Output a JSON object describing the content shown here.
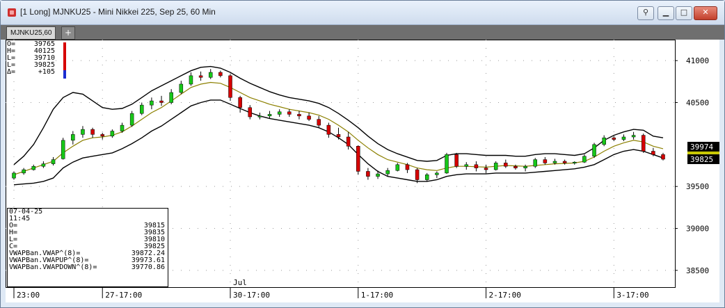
{
  "window": {
    "title": "[1 Long]  MJNKU25 - Mini Nikkei 225, Sep 25, 60 Min",
    "tab_label": "MJNKU25,60",
    "tab_add_label": "+"
  },
  "ohlc_box": [
    {
      "k": "O=",
      "v": "39765"
    },
    {
      "k": "H=",
      "v": "40125"
    },
    {
      "k": "L=",
      "v": "39710"
    },
    {
      "k": "L=",
      "v": "39825"
    },
    {
      "k": "Δ=",
      "v": "+105"
    }
  ],
  "info_box": {
    "date": "07-04-25",
    "time": "11:45",
    "rows": [
      {
        "k": "O=",
        "v": "39815"
      },
      {
        "k": "H=",
        "v": "39835"
      },
      {
        "k": "L=",
        "v": "39810"
      },
      {
        "k": "C=",
        "v": "39825"
      },
      {
        "k": "VWAPBan.VWAP^(8)=",
        "v": "39872.24"
      },
      {
        "k": "VWAPBan.VWAPUP^(8)=",
        "v": "39973.61"
      },
      {
        "k": "VWAPBan.VWAPDOWN^(8)=",
        "v": "39770.86"
      }
    ]
  },
  "colors": {
    "up": "#18c718",
    "down": "#d60000",
    "vwap": "#8c8000",
    "band": "#000000",
    "price_marker": "#000000",
    "vwap_marker": "#c8c800"
  },
  "chart_data": {
    "type": "candlestick",
    "title": "MJNKU25 - Mini Nikkei 225, Sep 25, 60 Min",
    "ylim": [
      38300,
      41250
    ],
    "y_ticks": [
      41000,
      40500,
      39500,
      39000,
      38500
    ],
    "y_tick_labels": [
      "41000",
      "40500",
      "39500",
      "39000",
      "38500"
    ],
    "x_labels": [
      {
        "label": "23:00",
        "index": 0
      },
      {
        "label": "27-17:00",
        "index": 9
      },
      {
        "label": "30-17:00",
        "index": 22
      },
      {
        "label": "1-17:00",
        "index": 35
      },
      {
        "label": "2-17:00",
        "index": 48
      },
      {
        "label": "3-17:00",
        "index": 61
      }
    ],
    "month_label": {
      "label": "Jul",
      "index": 22
    },
    "price_markers": [
      {
        "label": "39974",
        "value": 39974,
        "kind": "price"
      },
      {
        "label": "39825",
        "value": 39825,
        "kind": "price"
      }
    ],
    "candles": [
      [
        39600,
        39680,
        39580,
        39660
      ],
      [
        39660,
        39720,
        39640,
        39700
      ],
      [
        39700,
        39760,
        39690,
        39740
      ],
      [
        39740,
        39800,
        39720,
        39770
      ],
      [
        39770,
        39850,
        39750,
        39820
      ],
      [
        39830,
        40080,
        39820,
        40050
      ],
      [
        40050,
        40160,
        40000,
        40120
      ],
      [
        40120,
        40220,
        40080,
        40180
      ],
      [
        40180,
        40200,
        40080,
        40120
      ],
      [
        40120,
        40140,
        40060,
        40100
      ],
      [
        40100,
        40180,
        40080,
        40160
      ],
      [
        40160,
        40260,
        40140,
        40230
      ],
      [
        40230,
        40400,
        40210,
        40370
      ],
      [
        40370,
        40500,
        40350,
        40470
      ],
      [
        40470,
        40560,
        40420,
        40520
      ],
      [
        40520,
        40580,
        40460,
        40500
      ],
      [
        40500,
        40660,
        40480,
        40620
      ],
      [
        40620,
        40760,
        40600,
        40720
      ],
      [
        40720,
        40860,
        40700,
        40820
      ],
      [
        40820,
        40870,
        40760,
        40800
      ],
      [
        40800,
        40900,
        40780,
        40860
      ],
      [
        40860,
        40880,
        40800,
        40820
      ],
      [
        40820,
        40840,
        40520,
        40560
      ],
      [
        40560,
        40580,
        40380,
        40440
      ],
      [
        40440,
        40470,
        40300,
        40330
      ],
      [
        40330,
        40380,
        40300,
        40340
      ],
      [
        40340,
        40400,
        40310,
        40360
      ],
      [
        40360,
        40420,
        40330,
        40390
      ],
      [
        40390,
        40420,
        40330,
        40360
      ],
      [
        40360,
        40400,
        40300,
        40340
      ],
      [
        40340,
        40380,
        40280,
        40300
      ],
      [
        40300,
        40340,
        40200,
        40230
      ],
      [
        40230,
        40260,
        40080,
        40120
      ],
      [
        40120,
        40200,
        40060,
        40090
      ],
      [
        40090,
        40150,
        39940,
        39980
      ],
      [
        39980,
        39990,
        39640,
        39680
      ],
      [
        39680,
        39720,
        39580,
        39620
      ],
      [
        39620,
        39690,
        39590,
        39650
      ],
      [
        39650,
        39720,
        39620,
        39690
      ],
      [
        39690,
        39780,
        39680,
        39760
      ],
      [
        39760,
        39780,
        39660,
        39700
      ],
      [
        39700,
        39720,
        39540,
        39580
      ],
      [
        39580,
        39660,
        39560,
        39640
      ],
      [
        39640,
        39680,
        39600,
        39660
      ],
      [
        39660,
        39900,
        39650,
        39880
      ],
      [
        39880,
        39900,
        39720,
        39740
      ],
      [
        39740,
        39790,
        39700,
        39760
      ],
      [
        39760,
        39800,
        39680,
        39720
      ],
      [
        39720,
        39760,
        39660,
        39700
      ],
      [
        39700,
        39800,
        39690,
        39780
      ],
      [
        39780,
        39820,
        39720,
        39740
      ],
      [
        39740,
        39760,
        39700,
        39720
      ],
      [
        39720,
        39760,
        39680,
        39740
      ],
      [
        39740,
        39840,
        39720,
        39820
      ],
      [
        39820,
        39850,
        39760,
        39780
      ],
      [
        39780,
        39830,
        39760,
        39800
      ],
      [
        39800,
        39820,
        39760,
        39780
      ],
      [
        39780,
        39800,
        39760,
        39790
      ],
      [
        39790,
        39880,
        39780,
        39860
      ],
      [
        39860,
        40020,
        39840,
        40000
      ],
      [
        40000,
        40110,
        39980,
        40080
      ],
      [
        40080,
        40100,
        40040,
        40060
      ],
      [
        40060,
        40120,
        40040,
        40090
      ],
      [
        40090,
        40150,
        40060,
        40110
      ],
      [
        40110,
        40130,
        39900,
        39920
      ],
      [
        39920,
        39960,
        39860,
        39880
      ],
      [
        39880,
        39900,
        39810,
        39825
      ]
    ],
    "series": [
      {
        "name": "VWAPBan.VWAP^(8)",
        "values": [
          39640,
          39680,
          39720,
          39760,
          39800,
          39900,
          39980,
          40050,
          40080,
          40090,
          40110,
          40150,
          40220,
          40300,
          40380,
          40440,
          40520,
          40600,
          40680,
          40720,
          40740,
          40730,
          40680,
          40620,
          40560,
          40520,
          40480,
          40450,
          40420,
          40400,
          40380,
          40350,
          40300,
          40230,
          40150,
          40050,
          39960,
          39880,
          39820,
          39790,
          39760,
          39720,
          39700,
          39690,
          39720,
          39740,
          39740,
          39735,
          39730,
          39740,
          39750,
          39745,
          39740,
          39750,
          39760,
          39770,
          39775,
          39780,
          39800,
          39850,
          39920,
          39980,
          40020,
          40050,
          40030,
          39980,
          39950
        ]
      },
      {
        "name": "VWAPBan.VWAPUP^(8)",
        "values": [
          39760,
          39860,
          40000,
          40200,
          40420,
          40560,
          40620,
          40600,
          40520,
          40440,
          40420,
          40430,
          40480,
          40560,
          40640,
          40700,
          40760,
          40820,
          40880,
          40920,
          40930,
          40910,
          40860,
          40790,
          40730,
          40680,
          40630,
          40590,
          40560,
          40540,
          40520,
          40490,
          40440,
          40370,
          40290,
          40200,
          40100,
          40010,
          39940,
          39890,
          39850,
          39810,
          39800,
          39810,
          39870,
          39890,
          39890,
          39880,
          39870,
          39870,
          39870,
          39860,
          39860,
          39880,
          39890,
          39890,
          39880,
          39870,
          39890,
          39960,
          40050,
          40110,
          40150,
          40180,
          40170,
          40100,
          40080
        ]
      },
      {
        "name": "VWAPBan.VWAPDOWN^(8)",
        "values": [
          39520,
          39530,
          39540,
          39560,
          39600,
          39720,
          39790,
          39840,
          39860,
          39880,
          39900,
          39950,
          40010,
          40080,
          40160,
          40220,
          40300,
          40380,
          40460,
          40500,
          40530,
          40530,
          40480,
          40430,
          40380,
          40340,
          40310,
          40290,
          40270,
          40250,
          40230,
          40200,
          40150,
          40080,
          40000,
          39880,
          39770,
          39680,
          39620,
          39600,
          39580,
          39560,
          39560,
          39580,
          39620,
          39640,
          39650,
          39650,
          39650,
          39660,
          39660,
          39660,
          39660,
          39670,
          39680,
          39690,
          39700,
          39710,
          39730,
          39760,
          39820,
          39880,
          39920,
          39940,
          39920,
          39880,
          39840
        ]
      }
    ]
  }
}
